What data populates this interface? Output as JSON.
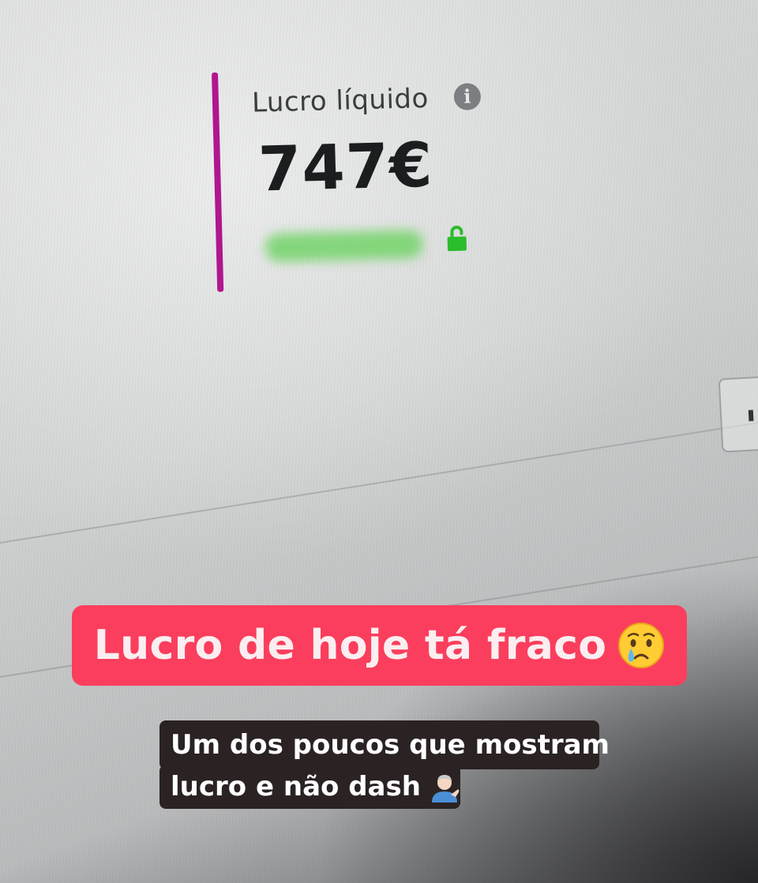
{
  "metric": {
    "label": "Lucro líquido",
    "value": "747€",
    "accent_color": "#b0168e",
    "secondary_value_state": "blurred",
    "secondary_value_color": "#74d46a",
    "info_icon": "info-icon",
    "lock_icon": "unlocked-padlock-icon",
    "lock_color": "#2bbd2b"
  },
  "overlay": {
    "headline": "Lucro de hoje tá fraco",
    "headline_emoji": "crying-face-emoji",
    "headline_bg": "#fb3e5d",
    "caption_line1": "Um dos poucos que mostram",
    "caption_line2": "lucro e não dash",
    "caption_emoji": "person-tipping-hand-emoji",
    "caption_bg": "#2a2223"
  }
}
